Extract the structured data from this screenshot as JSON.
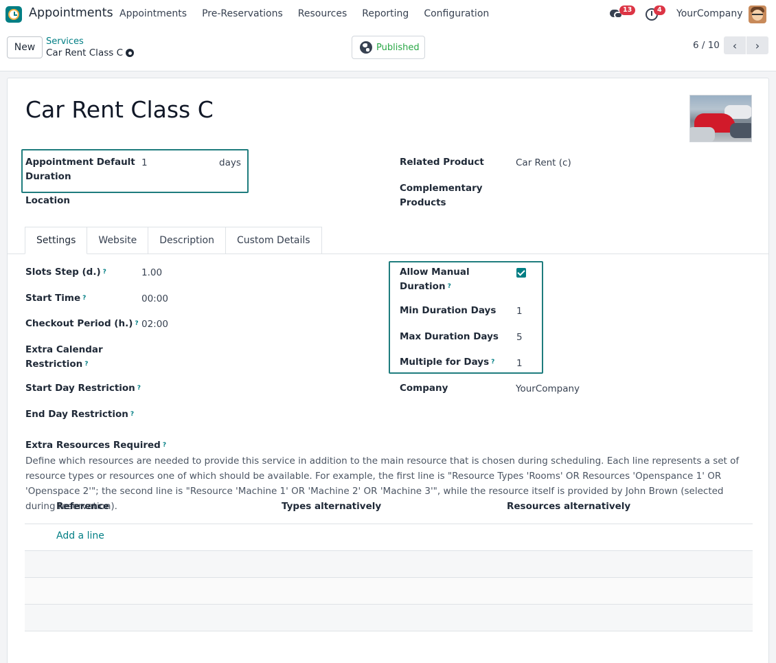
{
  "navbar": {
    "app_name": "Appointments",
    "menu": [
      "Appointments",
      "Pre-Reservations",
      "Resources",
      "Reporting",
      "Configuration"
    ],
    "messages_count": "13",
    "activities_count": "4",
    "company": "YourCompany"
  },
  "control_panel": {
    "new_label": "New",
    "breadcrumb_parent": "Services",
    "breadcrumb_current": "Car Rent Class C",
    "published_label": "Published",
    "pager": "6 / 10",
    "prev_glyph": "‹",
    "next_glyph": "›"
  },
  "record": {
    "title": "Car Rent Class C",
    "duration_label_1": "Appointment Default",
    "duration_label_2": "Duration",
    "duration_value": "1",
    "duration_unit": "days",
    "location_label": "Location",
    "related_product_label": "Related Product",
    "related_product_value": "Car Rent (c)",
    "complementary_label_1": "Complementary",
    "complementary_label_2": "Products"
  },
  "tabs": [
    "Settings",
    "Website",
    "Description",
    "Custom Details"
  ],
  "settings": {
    "slots_step_label": "Slots Step (d.)",
    "slots_step_value": "1.00",
    "start_time_label": "Start Time",
    "start_time_value": "00:00",
    "checkout_label": "Checkout Period (h.)",
    "checkout_value": "02:00",
    "extra_cal_label_1": "Extra Calendar",
    "extra_cal_label_2": "Restriction",
    "start_day_label": "Start Day Restriction",
    "end_day_label": "End Day Restriction",
    "allow_manual_label_1": "Allow Manual",
    "allow_manual_label_2": "Duration",
    "min_days_label": "Min Duration Days",
    "min_days_value": "1",
    "max_days_label": "Max Duration Days",
    "max_days_value": "5",
    "multiple_label": "Multiple for Days",
    "multiple_value": "1",
    "company_label": "Company",
    "company_value": "YourCompany",
    "help_mark": "?"
  },
  "extra_resources": {
    "label": "Extra Resources Required",
    "description": "Define which resources are needed to provide this service in addition to the main resource that is chosen during scheduling. Each line represents a set of resource types or resources one of which should be available. For example, the first line is \"Resource Types 'Rooms' OR Resources 'Openspance 1' OR 'Openspace 2'\"; the second line is \"Resource 'Machine 1' OR 'Machine 2' OR 'Machine 3'\", while the resource itself is provided by John Brown (selected during reservation).",
    "columns": [
      "Reference",
      "Types alternatively",
      "Resources alternatively"
    ],
    "add_line": "Add a line"
  }
}
